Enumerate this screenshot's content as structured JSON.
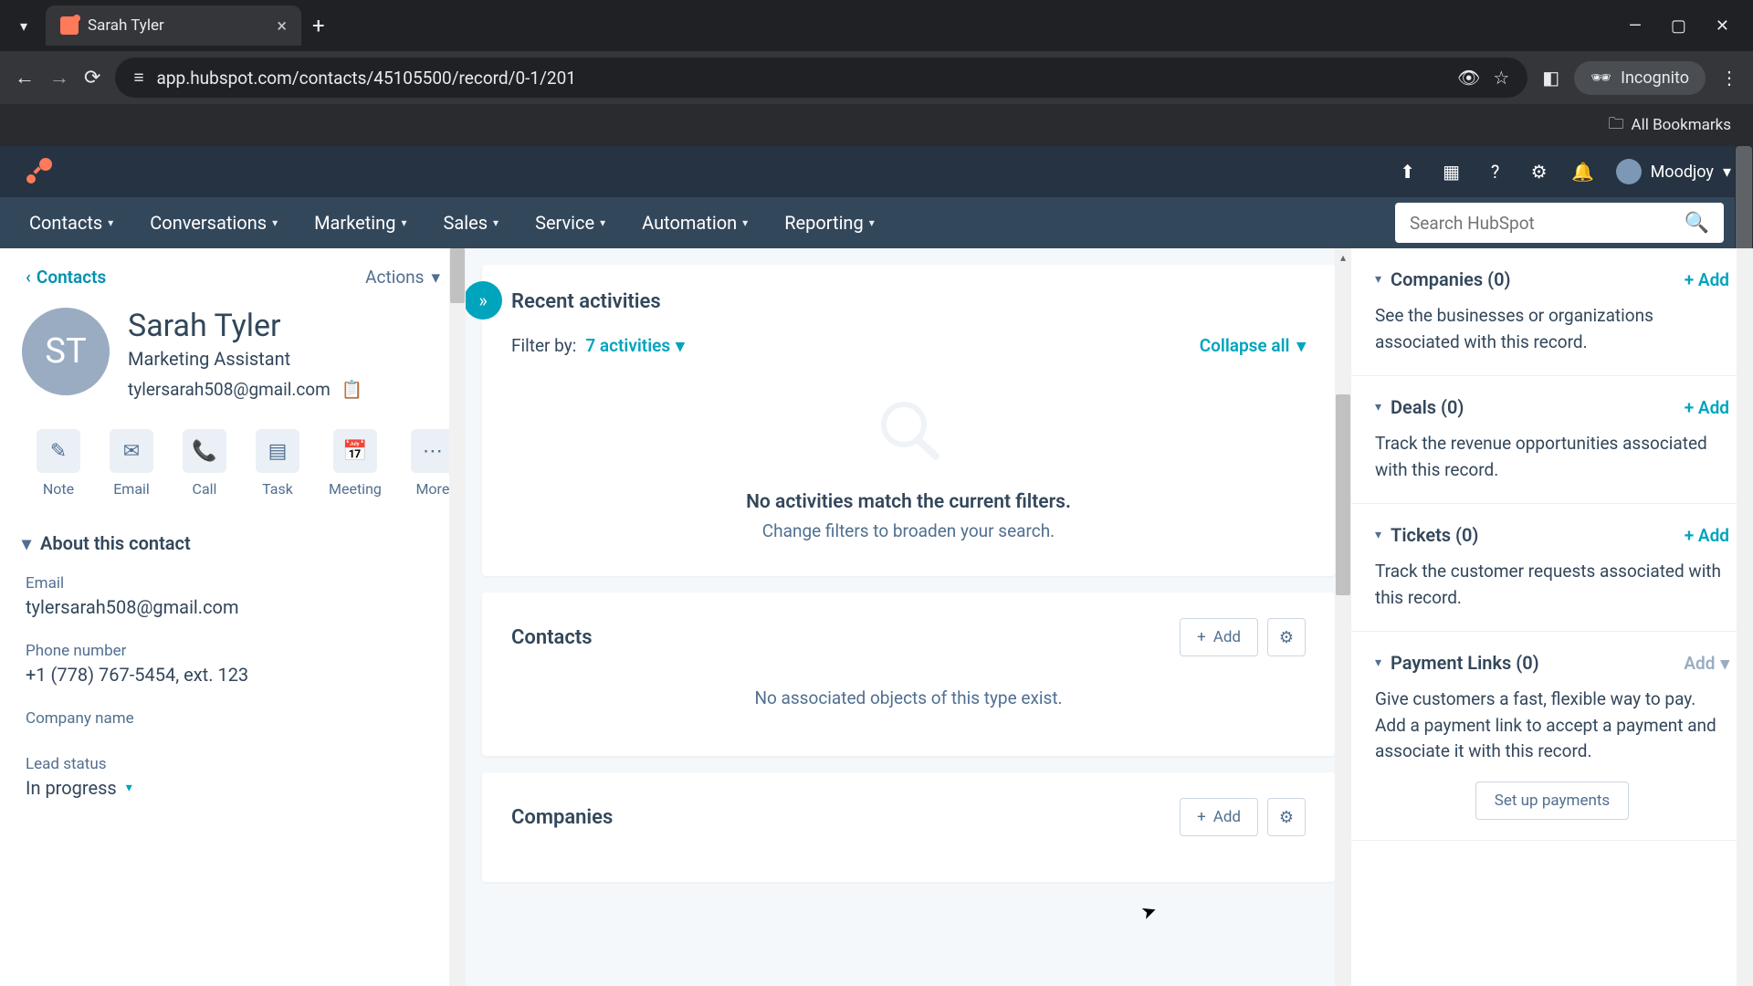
{
  "browser": {
    "tab_title": "Sarah Tyler",
    "url": "app.hubspot.com/contacts/45105500/record/0-1/201",
    "incognito_label": "Incognito",
    "all_bookmarks": "All Bookmarks"
  },
  "header": {
    "user_name": "Moodjoy"
  },
  "nav": {
    "items": [
      "Contacts",
      "Conversations",
      "Marketing",
      "Sales",
      "Service",
      "Automation",
      "Reporting"
    ],
    "search_placeholder": "Search HubSpot"
  },
  "left": {
    "back_label": "Contacts",
    "actions_label": "Actions",
    "avatar_initials": "ST",
    "name": "Sarah Tyler",
    "title": "Marketing Assistant",
    "email": "tylersarah508@gmail.com",
    "actions": [
      "Note",
      "Email",
      "Call",
      "Task",
      "Meeting",
      "More"
    ],
    "about_header": "About this contact",
    "fields": {
      "email_label": "Email",
      "email_value": "tylersarah508@gmail.com",
      "phone_label": "Phone number",
      "phone_value": "+1 (778) 767-5454, ext. 123",
      "company_label": "Company name",
      "company_value": "",
      "lead_label": "Lead status",
      "lead_value": "In progress"
    }
  },
  "center": {
    "recent_title": "Recent activities",
    "filter_label": "Filter by:",
    "filter_count": "7 activities",
    "collapse_label": "Collapse all",
    "empty_title": "No activities match the current filters.",
    "empty_sub": "Change filters to broaden your search.",
    "contacts_title": "Contacts",
    "add_label": "Add",
    "no_assoc": "No associated objects of this type exist.",
    "companies_title": "Companies"
  },
  "right": {
    "companies": {
      "title": "Companies (0)",
      "add": "+ Add",
      "desc": "See the businesses or organizations associated with this record."
    },
    "deals": {
      "title": "Deals (0)",
      "add": "+ Add",
      "desc": "Track the revenue opportunities associated with this record."
    },
    "tickets": {
      "title": "Tickets (0)",
      "add": "+ Add",
      "desc": "Track the customer requests associated with this record."
    },
    "payment": {
      "title": "Payment Links (0)",
      "add": "Add",
      "desc": "Give customers a fast, flexible way to pay. Add a payment link to accept a payment and associate it with this record.",
      "setup": "Set up payments"
    }
  }
}
